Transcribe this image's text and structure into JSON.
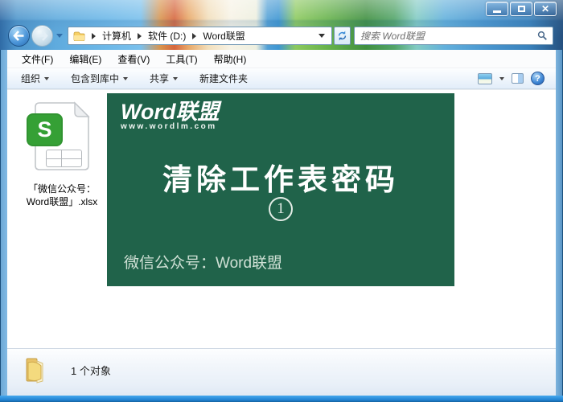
{
  "title_bar": {
    "close_glyph": "✕"
  },
  "navigation": {
    "breadcrumb": [
      "计算机",
      "软件 (D:)",
      "Word联盟"
    ],
    "search_placeholder": "搜索 Word联盟"
  },
  "menu_bar": [
    "文件(F)",
    "编辑(E)",
    "查看(V)",
    "工具(T)",
    "帮助(H)"
  ],
  "toolbar": {
    "organize": "组织",
    "include_in_library": "包含到库中",
    "share": "共享",
    "new_folder": "新建文件夹",
    "help_glyph": "?"
  },
  "content": {
    "file": {
      "label_line1": "「微信公众号：",
      "label_line2": "Word联盟」.xlsx",
      "icon_letter": "S"
    },
    "banner": {
      "logo_title": "Word联盟",
      "logo_subtitle": "www.wordlm.com",
      "title": "清除工作表密码",
      "step_number": "1",
      "footer": "微信公众号：Word联盟"
    }
  },
  "status_bar": {
    "items_count_text": "1 个对象"
  },
  "colors": {
    "banner_green": "#20634a",
    "wps_green": "#35a035",
    "aero_blue": "#5aa0d8",
    "border_blue": "#2182d2"
  }
}
